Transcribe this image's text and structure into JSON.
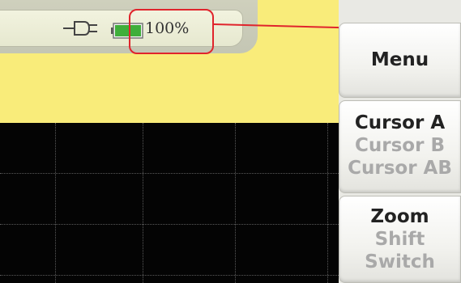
{
  "status_bar": {
    "power_icon": "plug-icon",
    "battery_icon": "battery-icon",
    "battery_color": "#3fae3a",
    "battery_level_text": "100%",
    "battery_level_fraction": 1.0
  },
  "annotation": {
    "callout_color": "#e0242c"
  },
  "softkeys": {
    "menu": {
      "label": "Menu"
    },
    "cursor": {
      "options": [
        "Cursor A",
        "Cursor B",
        "Cursor AB"
      ],
      "selected": "Cursor A"
    },
    "zoom": {
      "options": [
        "Zoom",
        "Shift",
        "Switch"
      ],
      "selected": "Zoom"
    }
  },
  "colors": {
    "yellow_background": "#f9ec7a",
    "plot_background": "#040404",
    "grid_line": "#5a5a5a",
    "active_text": "#222222",
    "inactive_text": "#a9a9a9"
  }
}
